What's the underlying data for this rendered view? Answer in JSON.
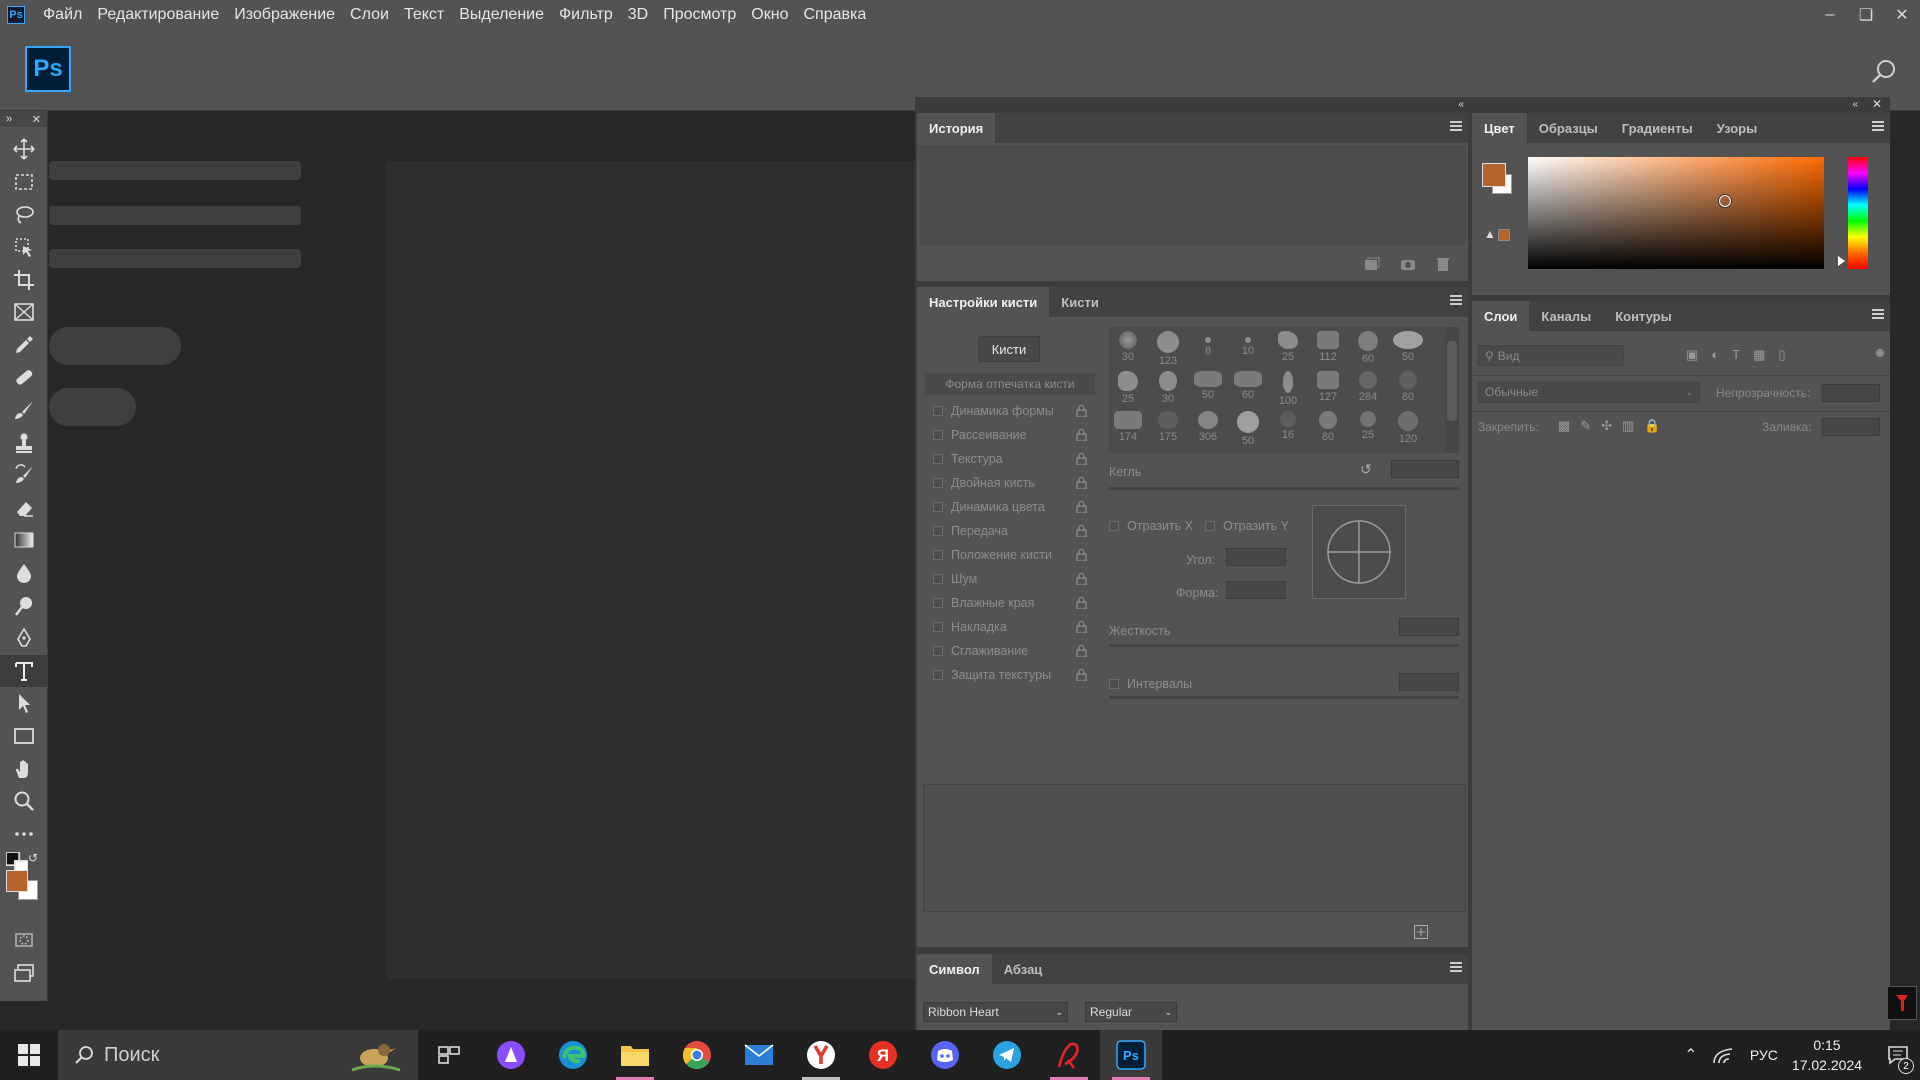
{
  "menubar": {
    "app_icon": "Ps",
    "items": [
      "Файл",
      "Редактирование",
      "Изображение",
      "Слои",
      "Текст",
      "Выделение",
      "Фильтр",
      "3D",
      "Просмотр",
      "Окно",
      "Справка"
    ],
    "window_buttons": [
      "minimize-icon",
      "restore-icon",
      "close-icon"
    ]
  },
  "optionsbar": {
    "logo": "Ps",
    "search_icon": "search-icon"
  },
  "tools": {
    "items": [
      "move-icon",
      "marquee-icon",
      "lasso-icon",
      "object-select-icon",
      "crop-icon",
      "frame-icon",
      "eyedropper-icon",
      "healing-icon",
      "brush-icon",
      "stamp-icon",
      "history-brush-icon",
      "eraser-icon",
      "gradient-icon",
      "blur-icon",
      "dodge-icon",
      "pen-icon",
      "type-icon",
      "path-select-icon",
      "rectangle-icon",
      "hand-icon",
      "zoom-icon",
      "more-icon"
    ],
    "active": "type-icon",
    "foreground_color": "#b5642b",
    "background_color": "#ffffff"
  },
  "history_panel": {
    "tab": "История"
  },
  "brush_settings": {
    "tabs": [
      "Настройки кисти",
      "Кисти"
    ],
    "brushes_button": "Кисти",
    "tip_shape_label": "Форма отпечатка кисти",
    "options": [
      "Динамика формы",
      "Рассеивание",
      "Текстура",
      "Двойная кисть",
      "Динамика цвета",
      "Передача",
      "Положение кисти",
      "Шум",
      "Влажные края",
      "Накладка",
      "Сглаживание",
      "Защита текстуры"
    ],
    "presets_row1": [
      "30",
      "123",
      "8",
      "10",
      "25",
      "112",
      "60",
      "50"
    ],
    "presets_row2": [
      "25",
      "30",
      "50",
      "60",
      "100",
      "127",
      "284",
      "80"
    ],
    "presets_row3": [
      "174",
      "175",
      "306",
      "50",
      "16",
      "80",
      "25",
      "120"
    ],
    "size_label": "Кегль",
    "flip_x": "Отразить X",
    "flip_y": "Отразить Y",
    "angle_label": "Угол:",
    "roundness_label": "Форма:",
    "hardness_label": "Жесткость",
    "spacing_label": "Интервалы"
  },
  "character_panel": {
    "tabs": [
      "Символ",
      "Абзац"
    ],
    "font_family": "Ribbon Heart",
    "font_style": "Regular"
  },
  "color_panel": {
    "tabs": [
      "Цвет",
      "Образцы",
      "Градиенты",
      "Узоры"
    ],
    "hue_color": "#ff6a00",
    "foreground": "#b5642b"
  },
  "layers_panel": {
    "tabs": [
      "Слои",
      "Каналы",
      "Контуры"
    ],
    "filter_placeholder": "Вид",
    "blend_mode": "Обычные",
    "opacity_label": "Непрозрачность:",
    "lock_label": "Закрепить:",
    "fill_label": "Заливка:"
  },
  "taskbar": {
    "search_text": "Поиск",
    "apps": [
      "task-view-icon",
      "alice-icon",
      "edge-icon",
      "explorer-icon",
      "chrome-icon",
      "mail-icon",
      "yandex-browser-icon",
      "yandex-icon",
      "discord-icon",
      "telegram-icon",
      "unknown-red-icon",
      "photoshop-icon"
    ],
    "language": "РУС",
    "time": "0:15",
    "date": "17.02.2024",
    "notifications": "2"
  }
}
